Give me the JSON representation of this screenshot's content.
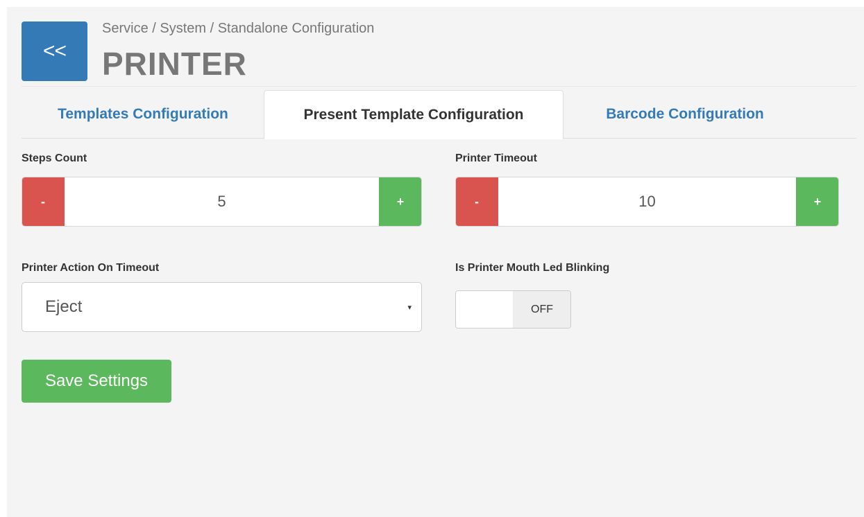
{
  "header": {
    "back_label": "<<",
    "breadcrumb": "Service / System / Standalone Configuration",
    "title": "PRINTER"
  },
  "tabs": [
    {
      "label": "Templates Configuration",
      "active": false
    },
    {
      "label": "Present Template Configuration",
      "active": true
    },
    {
      "label": "Barcode Configuration",
      "active": false
    }
  ],
  "form": {
    "steps_count": {
      "label": "Steps Count",
      "value": "5",
      "minus": "-",
      "plus": "+"
    },
    "printer_timeout": {
      "label": "Printer Timeout",
      "value": "10",
      "minus": "-",
      "plus": "+"
    },
    "action_on_timeout": {
      "label": "Printer Action On Timeout",
      "value": "Eject",
      "caret": "▾"
    },
    "led_blinking": {
      "label": "Is Printer Mouth Led Blinking",
      "state": "OFF"
    },
    "save_label": "Save Settings"
  },
  "colors": {
    "primary": "#337ab7",
    "danger": "#d9534f",
    "success": "#5cb85c",
    "panel_bg": "#f4f4f4"
  }
}
